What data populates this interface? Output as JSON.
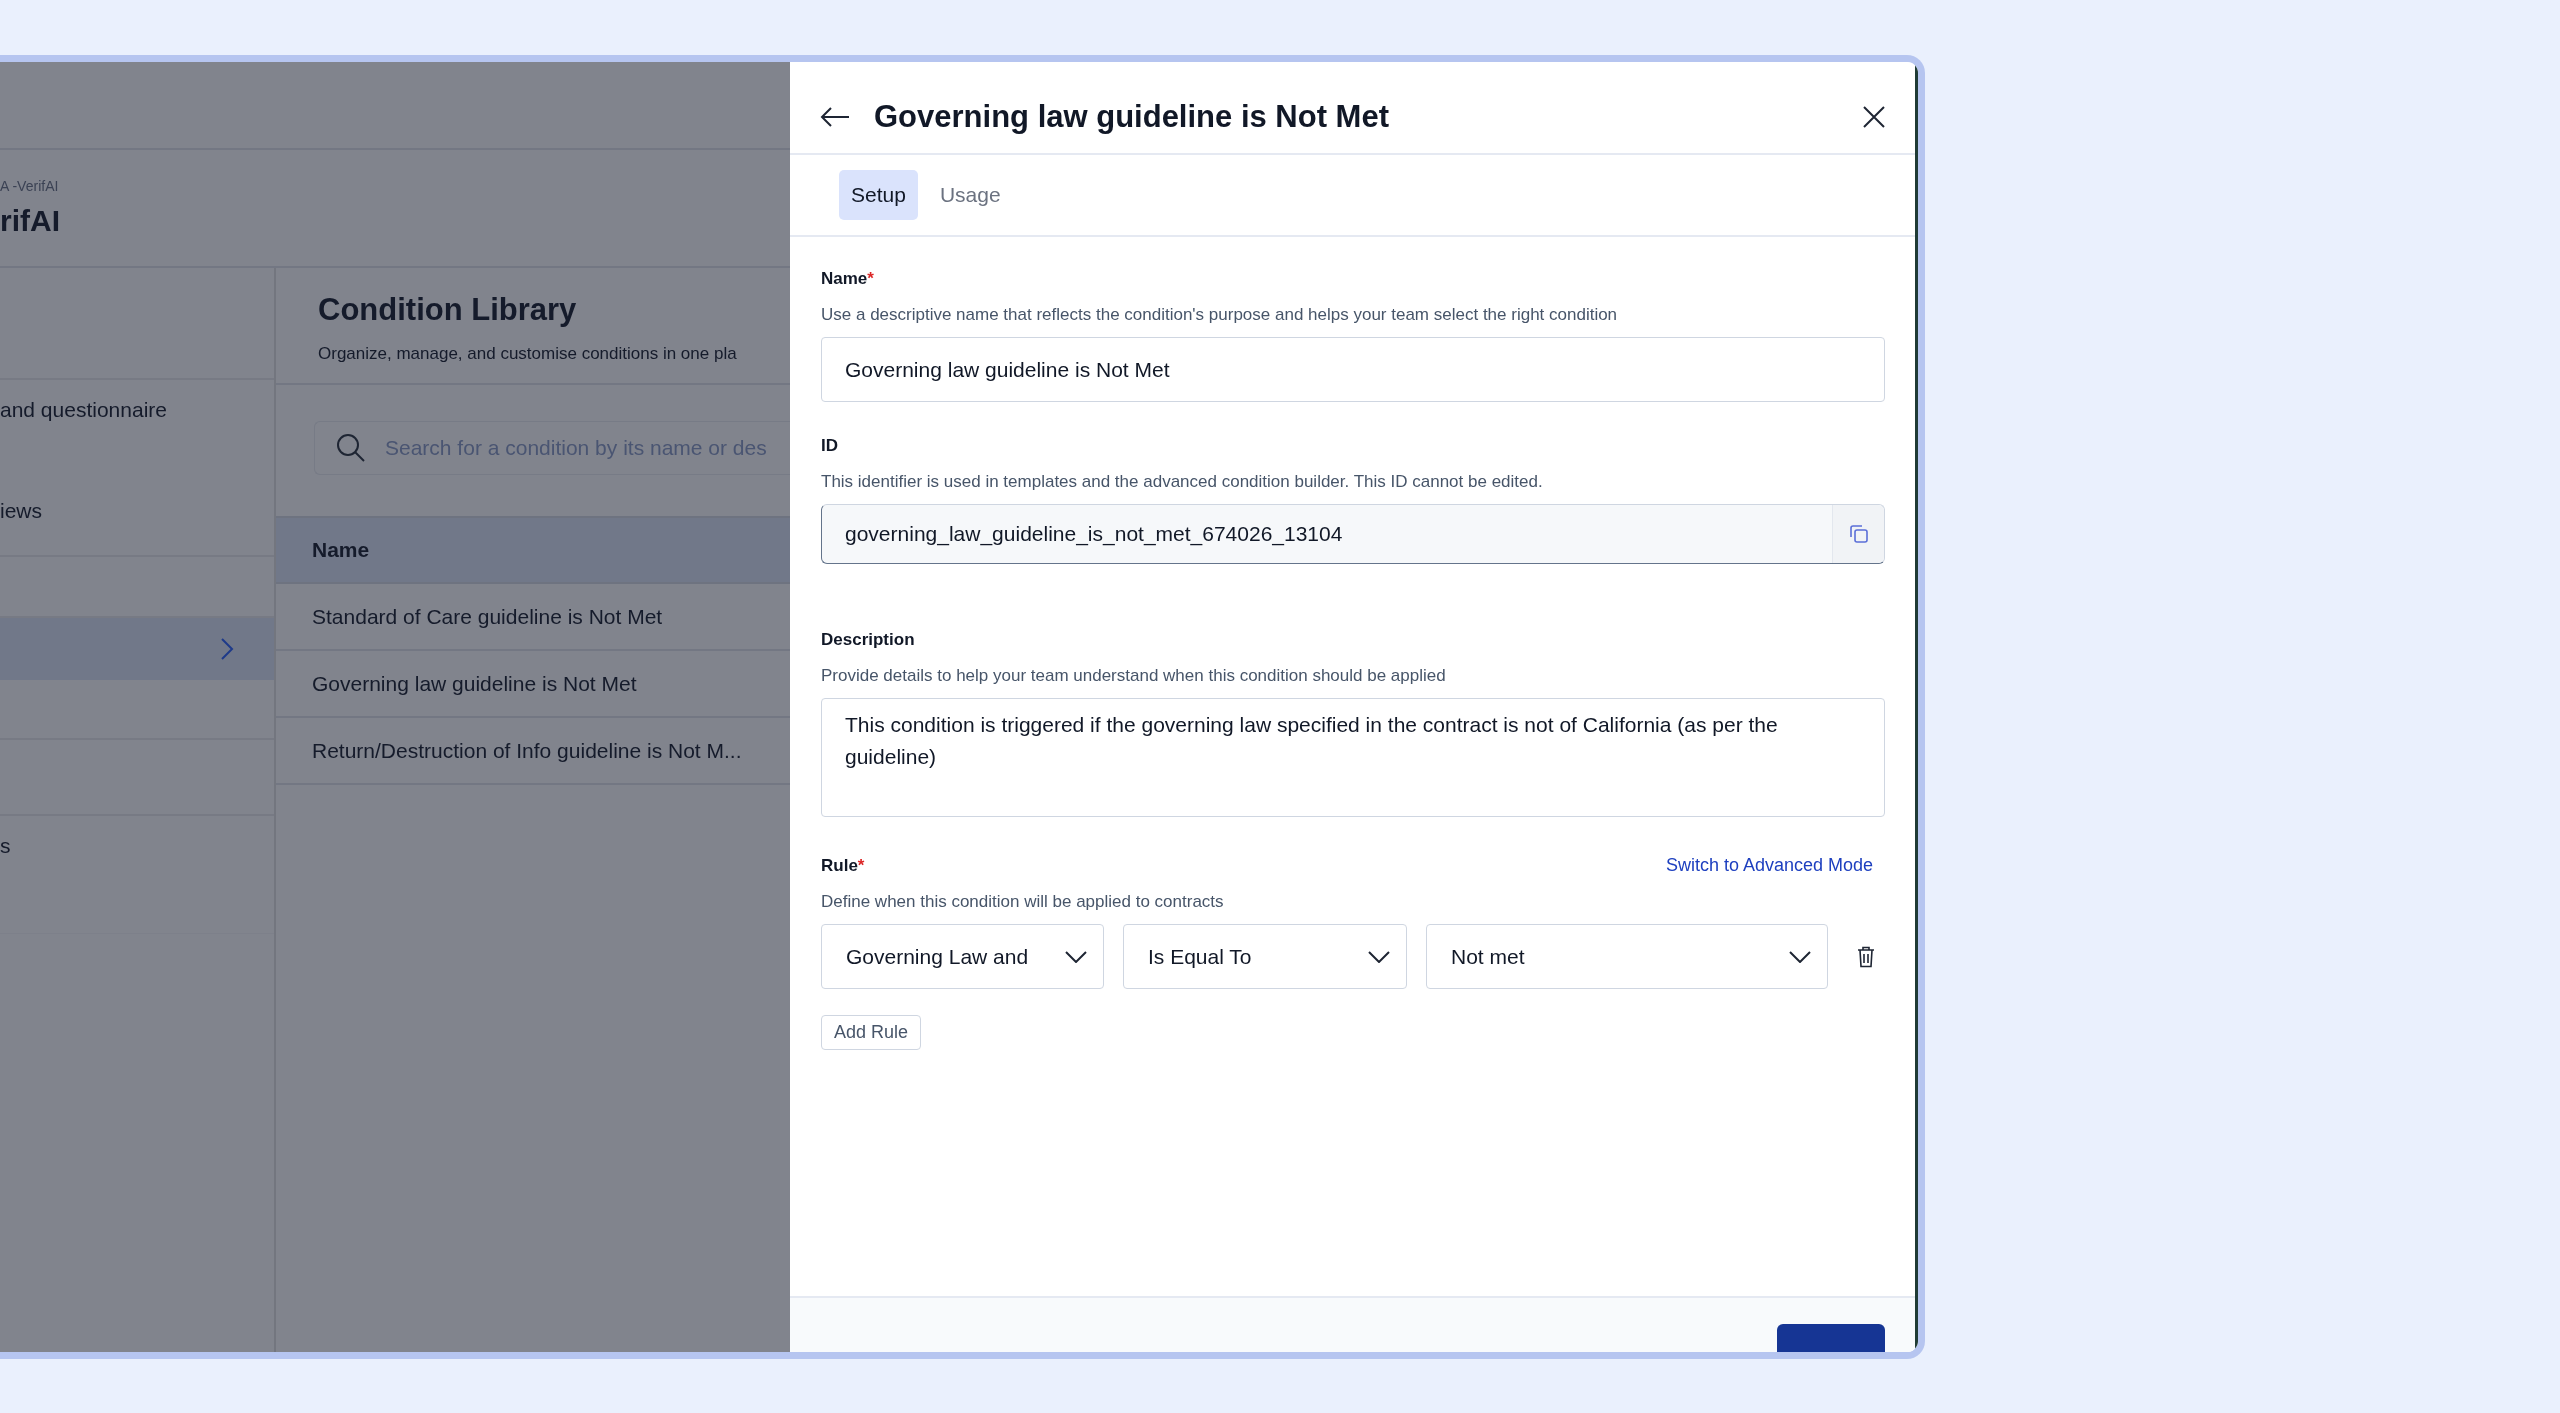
{
  "background": {
    "breadcrumb": "A -VerifAI",
    "app_title": "rifAI",
    "sidebar": {
      "items": [
        {
          "label": "and questionnaire",
          "selected": false
        },
        {
          "label": "iews",
          "selected": false
        },
        {
          "selected": true
        },
        {
          "label": "s",
          "selected": false
        }
      ]
    },
    "page": {
      "title": "Condition Library",
      "subtitle": "Organize, manage, and customise conditions in one pla",
      "search": {
        "placeholder": "Search for a condition by its name or des"
      },
      "table": {
        "columns": [
          "Name"
        ],
        "rows": [
          {
            "name": "Standard of Care guideline is Not Met"
          },
          {
            "name": "Governing law guideline is Not Met"
          },
          {
            "name": "Return/Destruction of Info guideline is Not M..."
          }
        ]
      }
    }
  },
  "panel": {
    "title": "Governing law guideline is Not Met",
    "required_mark": "*",
    "tabs": [
      {
        "label": "Setup",
        "selected": true
      },
      {
        "label": "Usage",
        "selected": false
      }
    ],
    "fields": [
      {
        "kind": "input",
        "label": "Name",
        "required": true,
        "help": "Use a descriptive name that reflects the condition's purpose and helps your team select the right condition",
        "value": "Governing law guideline is Not Met"
      },
      {
        "kind": "readonly",
        "label": "ID",
        "required": false,
        "help": "This identifier is used in templates and the advanced condition builder. This ID cannot be edited.",
        "value": "governing_law_guideline_is_not_met_674026_13104"
      },
      {
        "kind": "textarea",
        "label": "Description",
        "required": false,
        "help": "Provide details to help your team understand when this condition should be applied",
        "value": "This condition is triggered if the governing law specified in the contract is not of California (as per the guideline)"
      }
    ],
    "rule": {
      "label": "Rule",
      "required": true,
      "link": "Switch to Advanced Mode",
      "help": "Define when this condition will be applied to contracts",
      "selects": [
        {
          "value": "Governing Law and"
        },
        {
          "value": "Is Equal To"
        },
        {
          "value": "Not met"
        }
      ],
      "add_button": "Add Rule"
    }
  }
}
